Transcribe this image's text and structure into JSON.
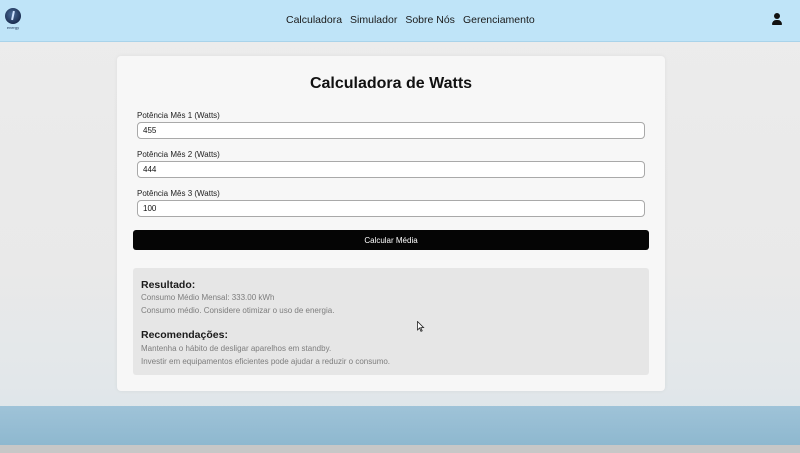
{
  "nav": {
    "logo_text": "energy",
    "links": [
      "Calculadora",
      "Simulador",
      "Sobre Nós",
      "Gerenciamento"
    ]
  },
  "calculator": {
    "title": "Calculadora de Watts",
    "fields": [
      {
        "label": "Potência Mês 1 (Watts)",
        "value": "455"
      },
      {
        "label": "Potência Mês 2 (Watts)",
        "value": "444"
      },
      {
        "label": "Potência Mês 3 (Watts)",
        "value": "100"
      }
    ],
    "button_label": "Calcular Média"
  },
  "result": {
    "heading": "Resultado:",
    "average": "Consumo Médio Mensal: 333.00 kWh",
    "assessment": "Consumo médio. Considere otimizar o uso de energia."
  },
  "recommendations": {
    "heading": "Recomendações:",
    "items": [
      "Mantenha o hábito de desligar aparelhos em standby.",
      "Investir em equipamentos eficientes pode ajudar a reduzir o consumo."
    ]
  },
  "colors": {
    "navbar": "#bfe4f8",
    "button": "#050505",
    "result_box": "#e6e6e6"
  },
  "icons": [
    "energy-logo-icon",
    "user-icon",
    "mouse-cursor-icon"
  ]
}
